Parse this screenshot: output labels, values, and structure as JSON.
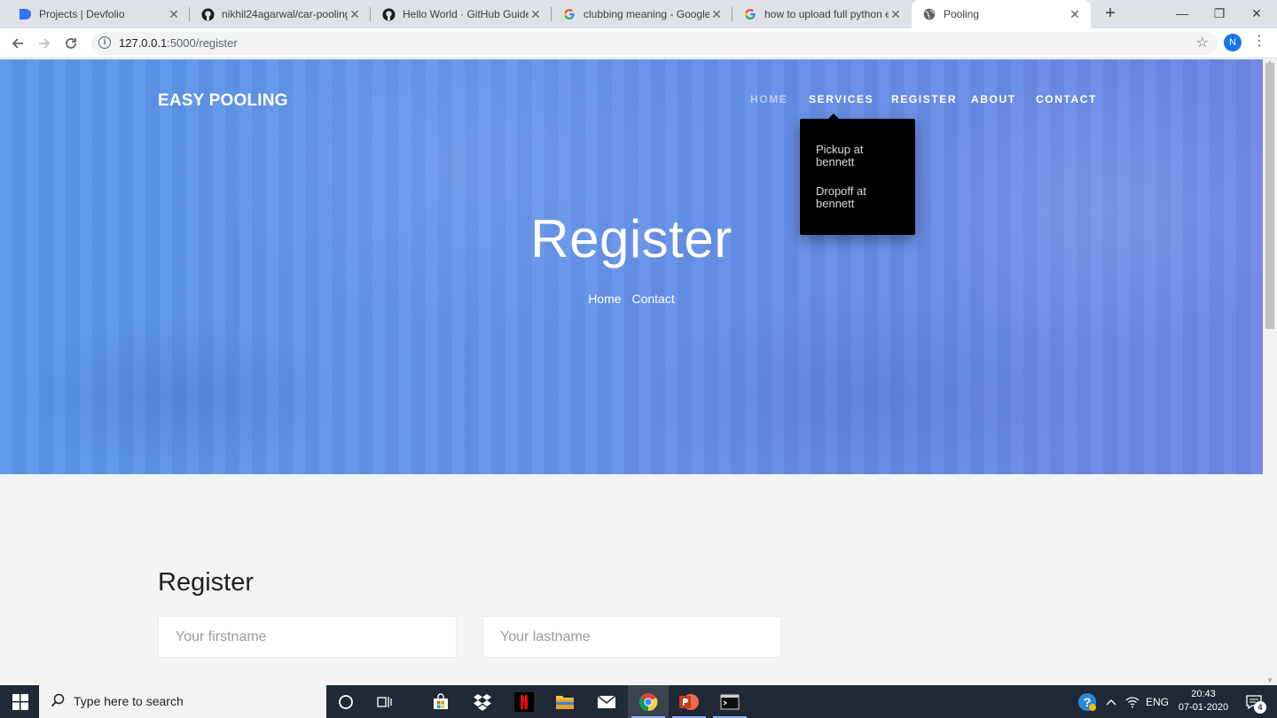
{
  "browser": {
    "tabs": [
      {
        "title": "Projects | Devfolio",
        "icon": "devfolio-icon"
      },
      {
        "title": "nikhil24agarwal/car-pooling",
        "icon": "github-icon"
      },
      {
        "title": "Hello World · GitHub Guides",
        "icon": "github-icon"
      },
      {
        "title": "clubbing meaning - Google S",
        "icon": "google-icon"
      },
      {
        "title": "how to upload full python en",
        "icon": "google-icon"
      },
      {
        "title": "Pooling",
        "icon": "globe-icon",
        "active": true
      }
    ],
    "url_host": "127.0.0.1",
    "url_path": ":5000/register",
    "profile_initial": "N"
  },
  "site": {
    "brand": "EASY POOLING",
    "nav": [
      "HOME",
      "SERVICES",
      "REGISTER",
      "ABOUT",
      "CONTACT"
    ],
    "services_dropdown": [
      "Pickup at bennett",
      "Dropoff at bennett"
    ],
    "hero_title": "Register",
    "breadcrumbs": [
      "Home",
      "Contact"
    ]
  },
  "form": {
    "title": "Register",
    "firstname_placeholder": "Your firstname",
    "lastname_placeholder": "Your lastname"
  },
  "taskbar": {
    "search_placeholder": "Type here to search",
    "language": "ENG",
    "time": "20:43",
    "date": "07-01-2020",
    "notification_count": "4"
  },
  "colors": {
    "hero_gradient_start": "#5b97e8",
    "hero_gradient_end": "#6d87e4",
    "dropdown_bg": "#000000",
    "taskbar_bg": "#1f2a36"
  }
}
